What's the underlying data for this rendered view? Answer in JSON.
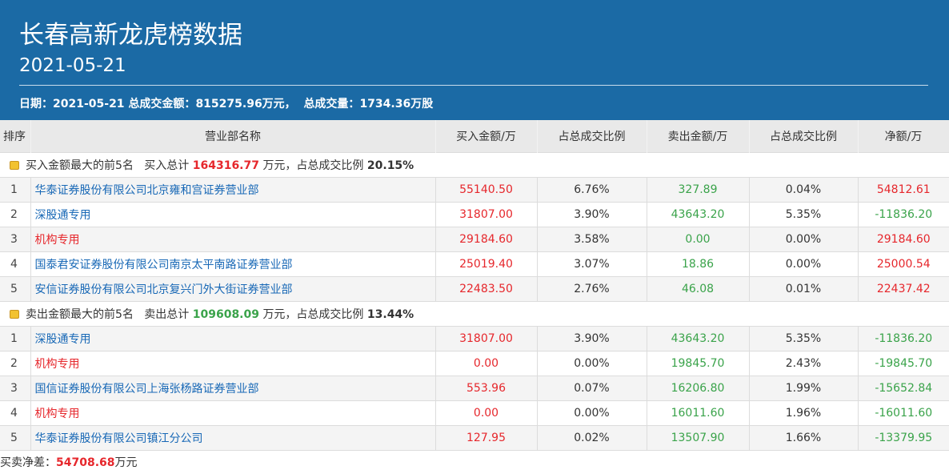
{
  "header": {
    "title": "长春高新龙虎榜数据",
    "date": "2021-05-21",
    "summary_date_label": "日期：",
    "summary_date": "2021-05-21",
    "summary_amount_label": "总成交金额：",
    "summary_amount": "815275.96万元，",
    "summary_volume_label": "总成交量：",
    "summary_volume": "1734.36万股"
  },
  "columns": [
    "排序",
    "营业部名称",
    "买入金额/万",
    "占总成交比例",
    "卖出金额/万",
    "占总成交比例",
    "净额/万"
  ],
  "buy_section": {
    "label": "买入金额最大的前5名",
    "total_label": "买入总计",
    "total": "164316.77",
    "unit_text": "万元，占总成交比例",
    "pct": "20.15%",
    "rows": [
      {
        "rank": "1",
        "name": "华泰证券股份有限公司北京雍和宫证券营业部",
        "buy": "55140.50",
        "buy_pct": "6.76%",
        "sell": "327.89",
        "sell_pct": "0.04%",
        "net": "54812.61"
      },
      {
        "rank": "2",
        "name": "深股通专用",
        "buy": "31807.00",
        "buy_pct": "3.90%",
        "sell": "43643.20",
        "sell_pct": "5.35%",
        "net": "-11836.20"
      },
      {
        "rank": "3",
        "name": "机构专用",
        "buy": "29184.60",
        "buy_pct": "3.58%",
        "sell": "0.00",
        "sell_pct": "0.00%",
        "net": "29184.60"
      },
      {
        "rank": "4",
        "name": "国泰君安证券股份有限公司南京太平南路证券营业部",
        "buy": "25019.40",
        "buy_pct": "3.07%",
        "sell": "18.86",
        "sell_pct": "0.00%",
        "net": "25000.54"
      },
      {
        "rank": "5",
        "name": "安信证券股份有限公司北京复兴门外大街证券营业部",
        "buy": "22483.50",
        "buy_pct": "2.76%",
        "sell": "46.08",
        "sell_pct": "0.01%",
        "net": "22437.42"
      }
    ]
  },
  "sell_section": {
    "label": "卖出金额最大的前5名",
    "total_label": "卖出总计",
    "total": "109608.09",
    "unit_text": "万元，占总成交比例",
    "pct": "13.44%",
    "rows": [
      {
        "rank": "1",
        "name": "深股通专用",
        "buy": "31807.00",
        "buy_pct": "3.90%",
        "sell": "43643.20",
        "sell_pct": "5.35%",
        "net": "-11836.20"
      },
      {
        "rank": "2",
        "name": "机构专用",
        "buy": "0.00",
        "buy_pct": "0.00%",
        "sell": "19845.70",
        "sell_pct": "2.43%",
        "net": "-19845.70"
      },
      {
        "rank": "3",
        "name": "国信证券股份有限公司上海张杨路证券营业部",
        "buy": "553.96",
        "buy_pct": "0.07%",
        "sell": "16206.80",
        "sell_pct": "1.99%",
        "net": "-15652.84"
      },
      {
        "rank": "4",
        "name": "机构专用",
        "buy": "0.00",
        "buy_pct": "0.00%",
        "sell": "16011.60",
        "sell_pct": "1.96%",
        "net": "-16011.60"
      },
      {
        "rank": "5",
        "name": "华泰证券股份有限公司镇江分公司",
        "buy": "127.95",
        "buy_pct": "0.02%",
        "sell": "13507.90",
        "sell_pct": "1.66%",
        "net": "-13379.95"
      }
    ]
  },
  "footer": {
    "label": "买卖净差：",
    "value": "54708.68",
    "unit": "万元"
  },
  "colors": {
    "header_bg": "#1b6aa5",
    "positive": "#e6272c",
    "negative": "#3aa34a",
    "link": "#1868b6"
  }
}
